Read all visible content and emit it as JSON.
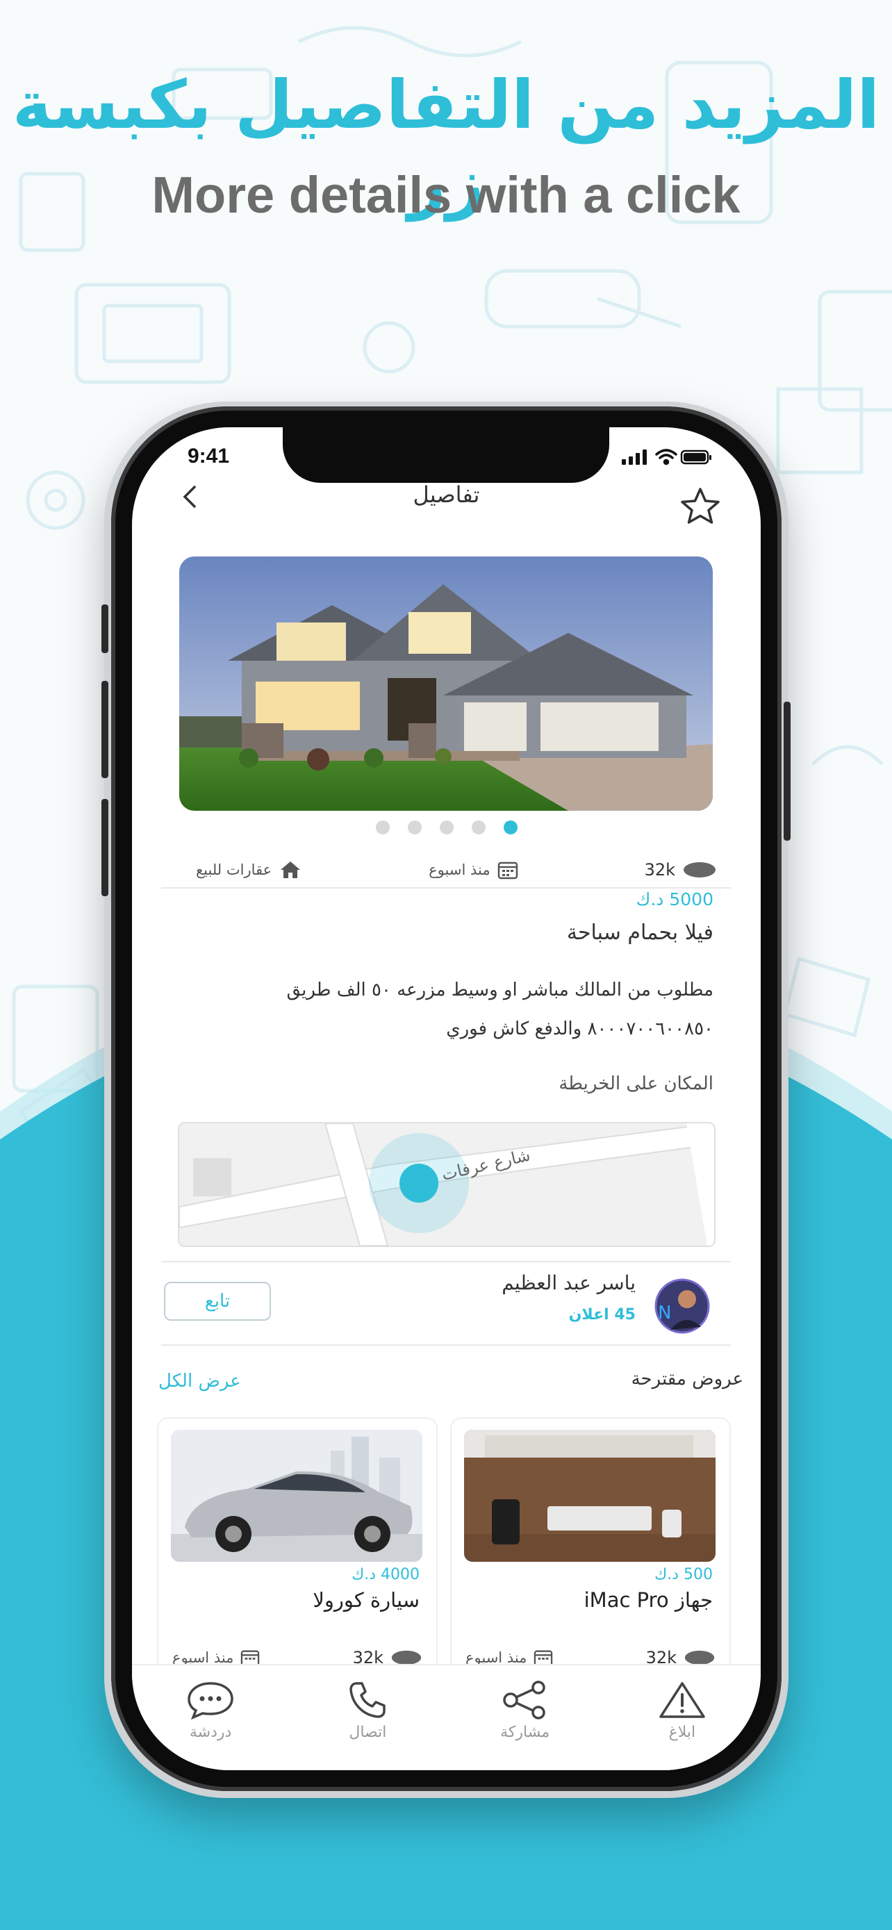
{
  "promo": {
    "headline_ar": "المزيد من التفاصيل بكبسة زر",
    "headline_en": "More details with a click"
  },
  "status_bar": {
    "time": "9:41"
  },
  "header": {
    "title": "تفاصيل"
  },
  "listing": {
    "image_dots": 5,
    "active_dot": 5,
    "views": "32k",
    "posted": "منذ اسبوع",
    "category": "عقارات للبيع",
    "price": "5000 د.ك",
    "title": "فيلا بحمام سباحة",
    "description_line1": "مطلوب من المالك مباشر او وسيط مزرعه ٥٠ الف طريق",
    "description_line2": "٨٠٠٠٧٠٠٦٠٠٨٥٠ والدفع كاش فوري",
    "map_label": "المكان على الخريطة",
    "map_street": "شارع عرفات"
  },
  "seller": {
    "name": "ياسر عبد العظيم",
    "ads_count": "45 اعلان",
    "follow_label": "تابع"
  },
  "suggestions": {
    "title": "عروض مقترحة",
    "view_all": "عرض الكل",
    "items": [
      {
        "price": "500 د.ك",
        "title": "جهاز  iMac Pro",
        "views": "32k",
        "posted": "منذ اسبوع"
      },
      {
        "price": "4000 د.ك",
        "title": "سيارة كورولا",
        "views": "32k",
        "posted": "منذ اسبوع"
      }
    ]
  },
  "tabbar": {
    "report": "ابلاغ",
    "share": "مشاركة",
    "call": "اتصال",
    "chat": "دردشة"
  },
  "colors": {
    "accent": "#2ebed8",
    "wave": "#34bdd6"
  }
}
